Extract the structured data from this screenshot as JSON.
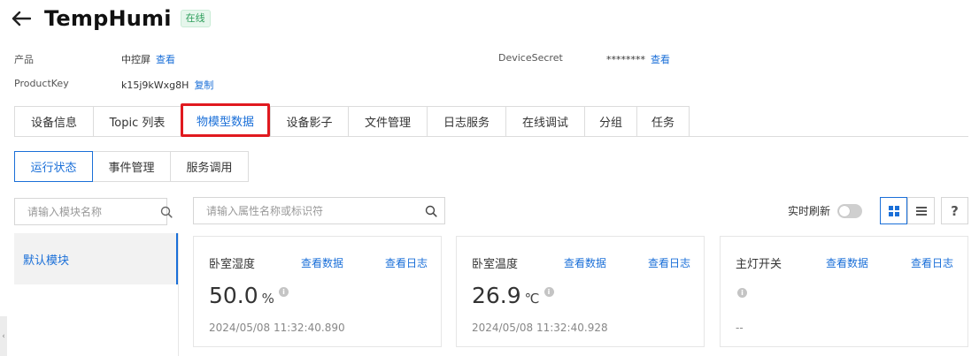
{
  "header": {
    "title": "TempHumi",
    "status": "在线"
  },
  "meta": {
    "product_label": "产品",
    "product_value": "中控屏",
    "product_link": "查看",
    "productkey_label": "ProductKey",
    "productkey_value": "k15j9kWxg8H",
    "productkey_link": "复制",
    "secret_label": "DeviceSecret",
    "secret_value": "********",
    "secret_link": "查看"
  },
  "tabs": [
    "设备信息",
    "Topic 列表",
    "物模型数据",
    "设备影子",
    "文件管理",
    "日志服务",
    "在线调试",
    "分组",
    "任务"
  ],
  "subtabs": [
    "运行状态",
    "事件管理",
    "服务调用"
  ],
  "module_search": {
    "placeholder": "请输入模块名称"
  },
  "property_search": {
    "placeholder": "请输入属性名称或标识符"
  },
  "module_list": [
    "默认模块"
  ],
  "toolbar": {
    "refresh_label": "实时刷新",
    "help": "?"
  },
  "cards": [
    {
      "name": "卧室湿度",
      "link_data": "查看数据",
      "link_log": "查看日志",
      "value": "50.0",
      "unit": "%",
      "time": "2024/05/08 11:32:40.890"
    },
    {
      "name": "卧室温度",
      "link_data": "查看数据",
      "link_log": "查看日志",
      "value": "26.9",
      "unit": "℃",
      "time": "2024/05/08 11:32:40.928"
    },
    {
      "name": "主灯开关",
      "link_data": "查看数据",
      "link_log": "查看日志",
      "value": "",
      "unit": "",
      "time": "--"
    }
  ],
  "colors": {
    "accent": "#1a6fd8",
    "highlight": "#e0191f",
    "online": "#2e9e5b"
  }
}
